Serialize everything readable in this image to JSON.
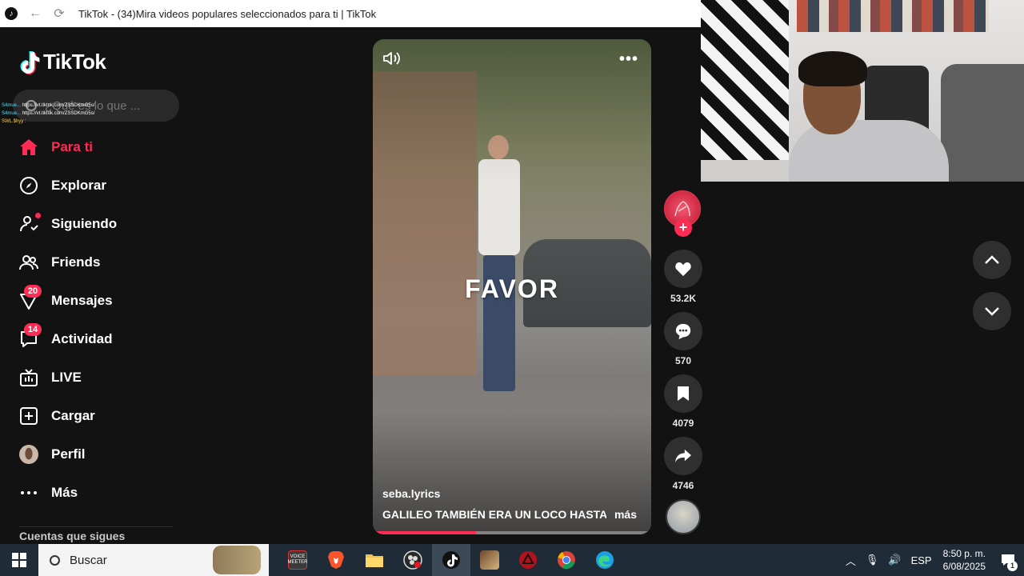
{
  "browser": {
    "title": "TikTok - (34)Mira videos populares seleccionados para ti | TikTok"
  },
  "brand": {
    "name": "TikTok",
    "accent": "#fe2c55"
  },
  "search": {
    "placeholder": "¿Qué es lo que ..."
  },
  "chat_overlay": [
    {
      "user": "S4mue...",
      "text": "https://vt.tiktok.com/ZSSDKmG5s/"
    },
    {
      "user": "S4mue...",
      "text": "https://vt.tiktok.com/ZSSDKmG5s/"
    },
    {
      "user": "SWL.$hyy",
      "text": ":"
    }
  ],
  "nav": {
    "items": [
      {
        "label": "Para ti",
        "icon": "home-icon",
        "active": true
      },
      {
        "label": "Explorar",
        "icon": "compass-icon"
      },
      {
        "label": "Siguiendo",
        "icon": "following-icon",
        "dot": true
      },
      {
        "label": "Friends",
        "icon": "friends-icon"
      },
      {
        "label": "Mensajes",
        "icon": "messages-icon",
        "badge": "20"
      },
      {
        "label": "Actividad",
        "icon": "activity-icon",
        "badge": "14"
      },
      {
        "label": "LIVE",
        "icon": "live-icon"
      },
      {
        "label": "Cargar",
        "icon": "upload-icon"
      },
      {
        "label": "Perfil",
        "icon": "profile-avatar"
      },
      {
        "label": "Más",
        "icon": "more-icon"
      }
    ],
    "following_title": "Cuentas que sigues"
  },
  "video": {
    "caption_word": "FAVOR",
    "author": "seba.lyrics",
    "description": "GALILEO TAMBIÉN ERA UN LOCO HASTA ...",
    "more_label": "más",
    "progress": 0.37
  },
  "actions": {
    "likes": "53.2K",
    "comments": "570",
    "saves": "4079",
    "shares": "4746"
  },
  "taskbar": {
    "search_placeholder": "Buscar",
    "language": "ESP",
    "time": "8:50 p. m.",
    "date": "6/08/2025",
    "notifications": "1",
    "apps": [
      {
        "name": "voicemeeter-icon",
        "color": "#3a3a3a",
        "label": "VOICE MEETER"
      },
      {
        "name": "brave-icon",
        "color": "#fb542b"
      },
      {
        "name": "file-explorer-icon",
        "color": "#f2c14e"
      },
      {
        "name": "obs-icon",
        "color": "#2a2a2a"
      },
      {
        "name": "tiktok-icon",
        "color": "#111111",
        "active": true
      },
      {
        "name": "game-icon",
        "color": "#6b4a2f"
      },
      {
        "name": "app-red-icon",
        "color": "#b3121a"
      },
      {
        "name": "chrome-icon",
        "color": "#4285f4"
      },
      {
        "name": "edge-icon",
        "color": "#1ba1e2"
      }
    ]
  }
}
